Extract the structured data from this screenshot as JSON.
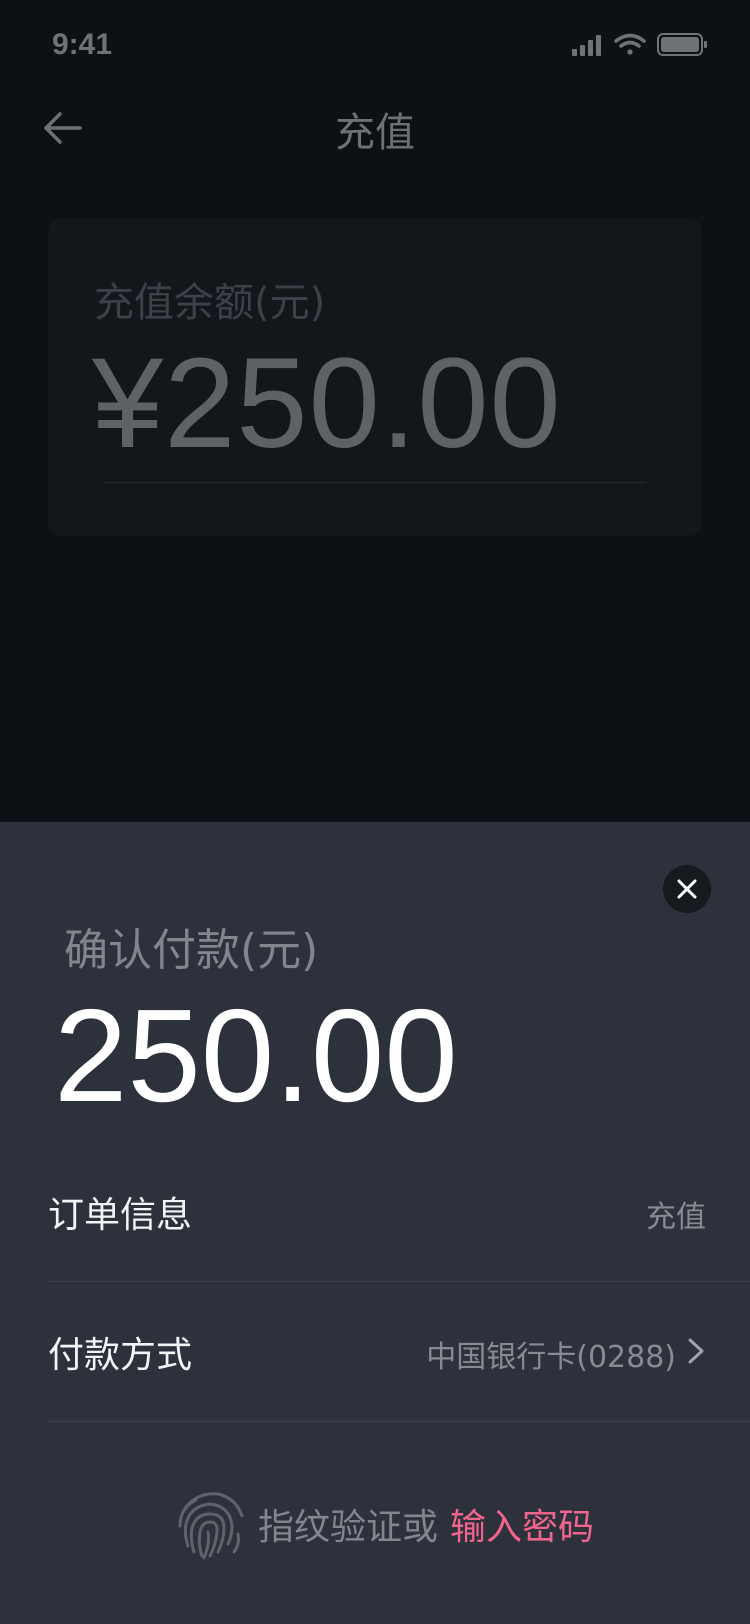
{
  "status_bar": {
    "time": "9:41",
    "icons": [
      "signal-icon",
      "wifi-icon",
      "battery-icon"
    ]
  },
  "nav": {
    "back_icon": "arrow-left-icon",
    "title": "充值"
  },
  "balance": {
    "label": "充值余额(元)",
    "value": "¥250.00"
  },
  "sheet": {
    "close_icon": "close-icon",
    "label": "确认付款(元)",
    "amount": "250.00",
    "order": {
      "label": "订单信息",
      "value": "充值"
    },
    "payment": {
      "label": "付款方式",
      "value": "中国银行卡(0288)"
    },
    "verify": {
      "prefix": "指纹验证或",
      "link": "输入密码",
      "icon": "fingerprint-icon"
    }
  },
  "colors": {
    "accent": "#f0648d",
    "sheet_bg": "#2c313b",
    "page_bg": "#0d1014"
  }
}
